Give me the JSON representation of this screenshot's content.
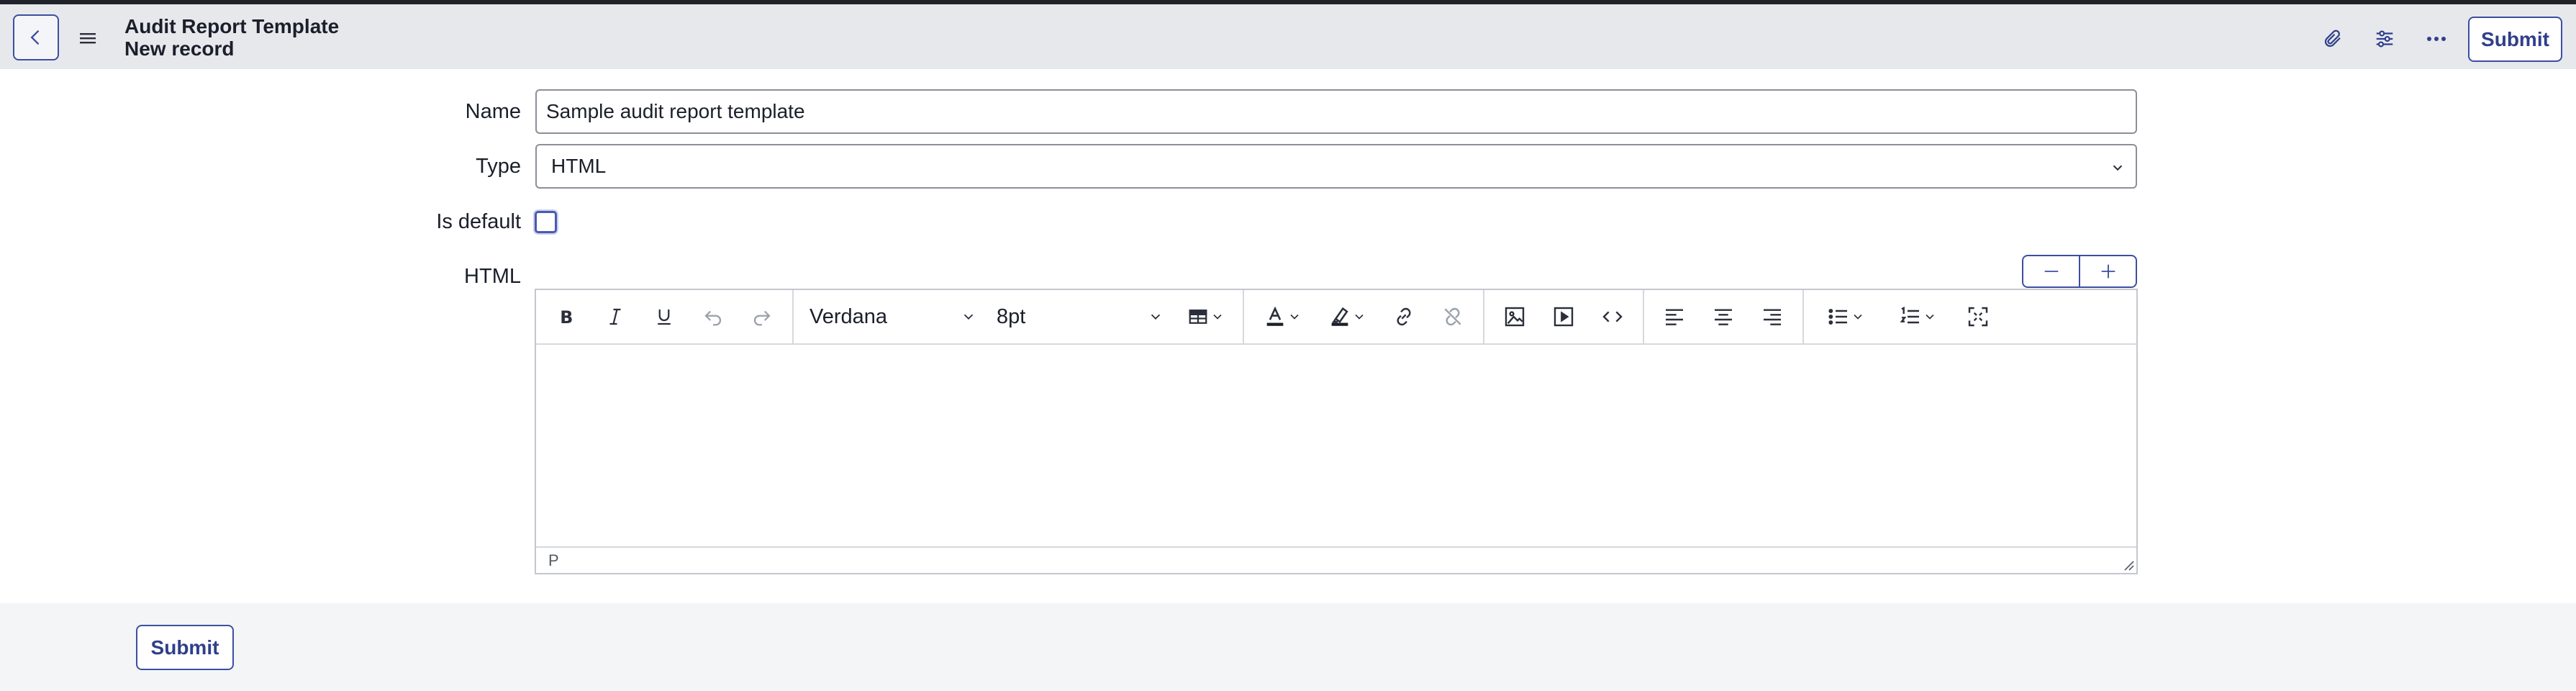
{
  "header": {
    "title": "Audit Report Template",
    "subtitle": "New record",
    "submit_label": "Submit",
    "icons": [
      "back-icon",
      "menu-icon",
      "paperclip-icon",
      "sliders-icon",
      "more-icon"
    ]
  },
  "form": {
    "name_label": "Name",
    "name_value": "Sample audit report template",
    "type_label": "Type",
    "type_value": "HTML",
    "is_default_label": "Is default",
    "is_default_checked": false,
    "html_label": "HTML"
  },
  "editor": {
    "font_family": "Verdana",
    "font_size": "8pt",
    "status_path": "P",
    "toolbar_icons": [
      "bold",
      "italic",
      "underline",
      "undo",
      "redo",
      "table",
      "text-color",
      "highlight",
      "link",
      "unlink",
      "image",
      "media",
      "code",
      "align-left",
      "align-center",
      "align-right",
      "bullet-list",
      "numbered-list",
      "fullscreen"
    ]
  },
  "footer": {
    "submit_label": "Submit"
  },
  "colors": {
    "accent": "#3d4ea0",
    "header_bg": "#e6e8ec",
    "footer_bg": "#f4f5f7"
  }
}
